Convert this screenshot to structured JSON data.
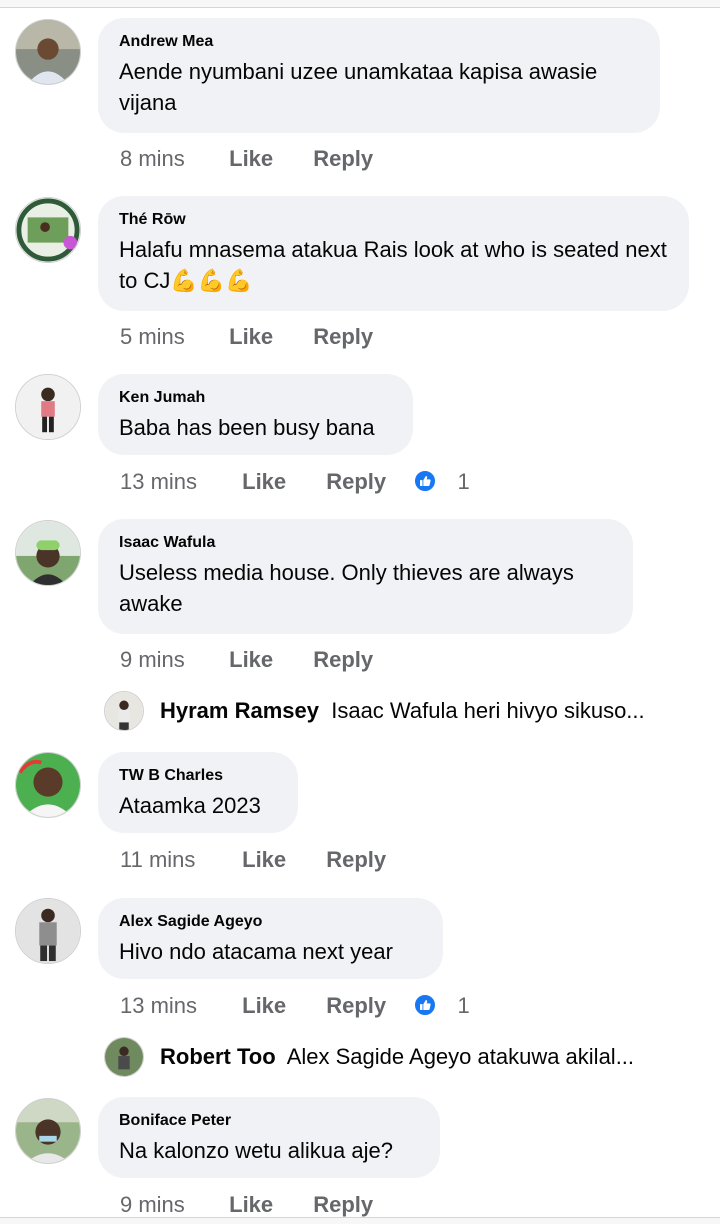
{
  "comments": [
    {
      "author": "Andrew Mea",
      "text": "Aende nyumbani uzee unamkataa kapisa awasie vijana",
      "time": "8 mins",
      "like": "Like",
      "reply": "Reply"
    },
    {
      "author": "Thé Rōw",
      "text": "Halafu mnasema atakua Rais look at who is seated next to CJ💪💪💪",
      "time": "5 mins",
      "like": "Like",
      "reply": "Reply"
    },
    {
      "author": "Ken Jumah",
      "text": "Baba has been busy bana",
      "time": "13 mins",
      "like": "Like",
      "reply": "Reply",
      "reactions": "1"
    },
    {
      "author": "Isaac Wafula",
      "text": "Useless media house. Only thieves are always awake",
      "time": "9 mins",
      "like": "Like",
      "reply": "Reply",
      "reply_preview": {
        "name": "Hyram Ramsey",
        "text": "Isaac Wafula heri  hivyo sikuso..."
      }
    },
    {
      "author": "TW B Charles",
      "text": "Ataamka 2023",
      "time": "11 mins",
      "like": "Like",
      "reply": "Reply"
    },
    {
      "author": "Alex Sagide Ageyo",
      "text": "Hivo ndo atacama next year",
      "time": "13 mins",
      "like": "Like",
      "reply": "Reply",
      "reactions": "1",
      "reply_preview": {
        "name": "Robert Too",
        "text": "Alex Sagide Ageyo atakuwa akilal..."
      }
    },
    {
      "author": "Boniface Peter",
      "text": "Na kalonzo wetu alikua aje?",
      "time": "9 mins",
      "like": "Like",
      "reply": "Reply"
    }
  ],
  "icons": {
    "reaction": "like-reaction-icon"
  },
  "colors": {
    "bubble": "#f0f2f5",
    "meta": "#65676b",
    "like_blue": "#1877f2"
  }
}
